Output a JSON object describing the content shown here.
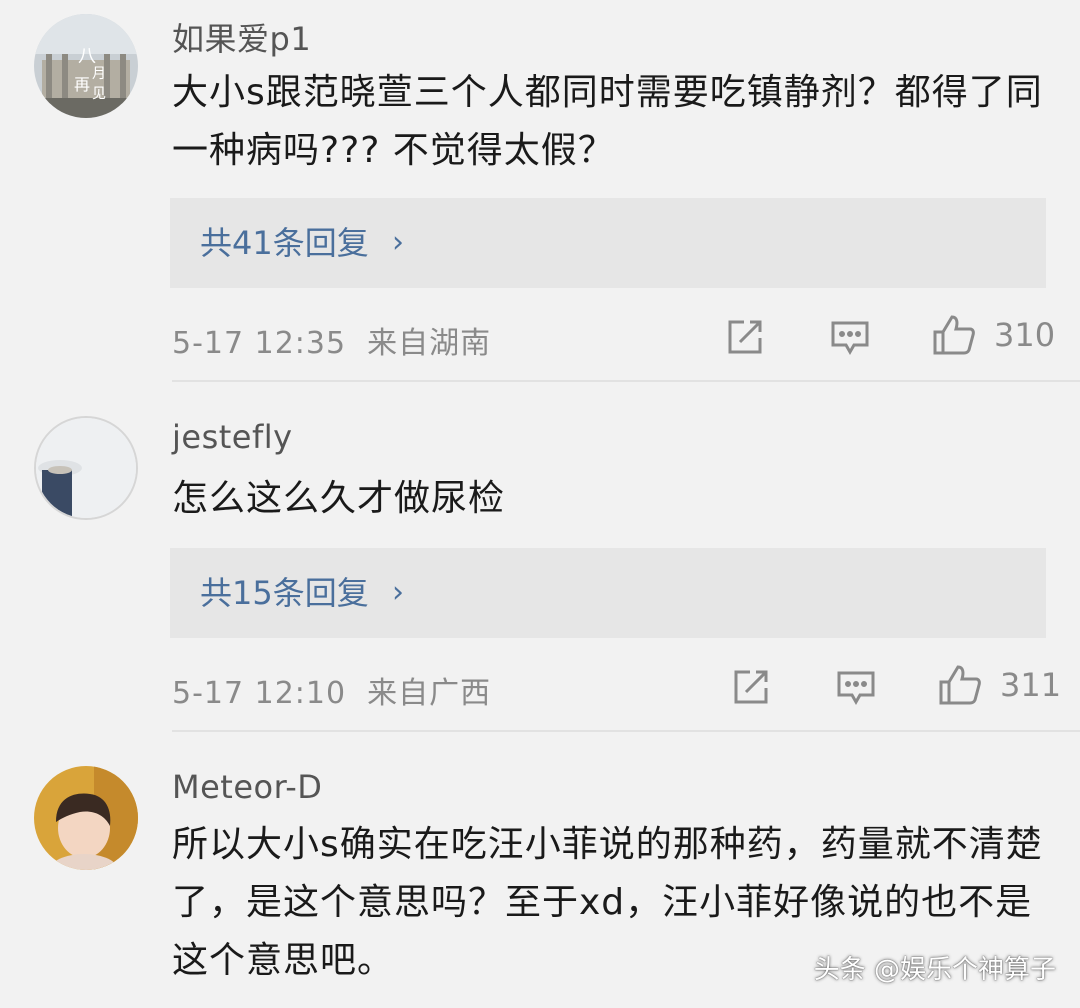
{
  "comments": [
    {
      "username": "如果爱p1",
      "text": "大小s跟范晓萱三个人都同时需要吃镇静剂？都得了同一种病吗??? 不觉得太假？",
      "replies_label": "共41条回复",
      "time": "5-17 12:35",
      "location": "来自湖南",
      "likes": "310",
      "avatar_text": "八\n再\n月\n见"
    },
    {
      "username": "jestefly",
      "text": "怎么这么久才做尿检",
      "replies_label": "共15条回复",
      "time": "5-17 12:10",
      "location": "来自广西",
      "likes": "311"
    },
    {
      "username": "Meteor-D",
      "text": "所以大小s确实在吃汪小菲说的那种药，药量就不清楚了，是这个意思吗？至于xd，汪小菲好像说的也不是这个意思吧。"
    }
  ],
  "icons": {
    "share": "share-icon",
    "reply": "comment-icon",
    "like": "thumbs-up-icon",
    "chevron": "chevron-right-icon"
  },
  "colors": {
    "background": "#f2f2f2",
    "reply_box": "#e6e6e6",
    "link": "#4a6f9c",
    "meta": "#8a8a8a"
  },
  "watermark": "头条 @娱乐个神算子"
}
